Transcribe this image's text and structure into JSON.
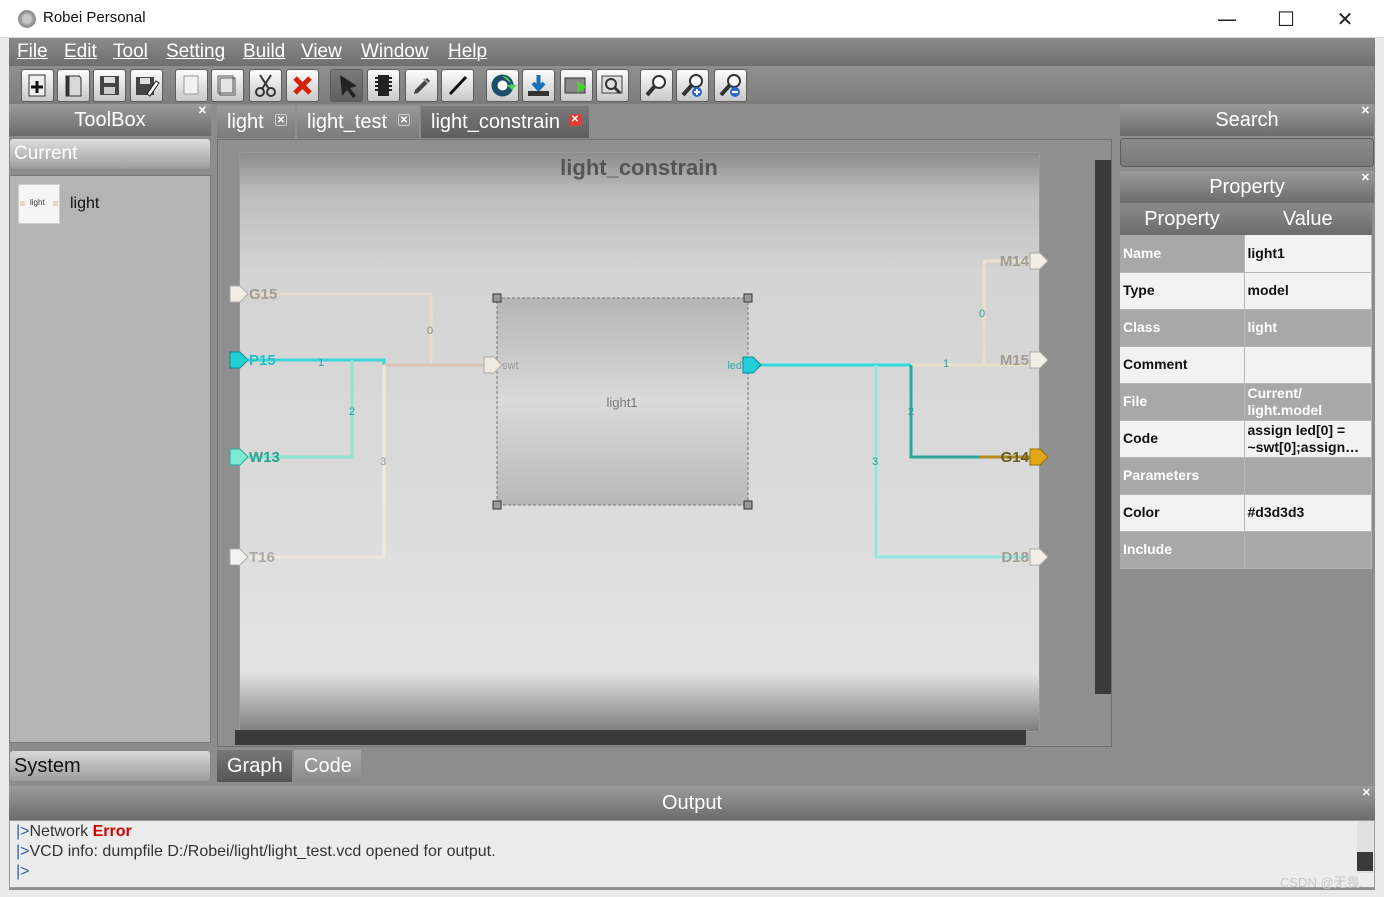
{
  "window": {
    "title": "Robei  Personal",
    "minimize": "—",
    "maximize": "☐",
    "close": "✕"
  },
  "menu": [
    "File",
    "Edit",
    "Tool",
    "Setting",
    "Build",
    "View",
    "Window",
    "Help"
  ],
  "toolbar": {
    "icons": [
      "new-file-icon",
      "open-book-icon",
      "save-icon",
      "save-as-icon",
      "copy-icon",
      "paste-icon",
      "cut-icon",
      "delete-icon",
      "pointer-icon",
      "chip-icon",
      "pen-icon",
      "wire-icon",
      "run-icon",
      "download-icon",
      "simulate-icon",
      "view-waveform-icon",
      "zoom-fit-icon",
      "zoom-in-icon",
      "zoom-out-icon"
    ]
  },
  "toolbox": {
    "title": "ToolBox",
    "current_label": "Current",
    "item_icon_text": "light",
    "item_label": "light",
    "system_label": "System"
  },
  "tabs": [
    {
      "label": "light",
      "active": false
    },
    {
      "label": "light_test",
      "active": false
    },
    {
      "label": "light_constrain",
      "active": true
    }
  ],
  "diagram": {
    "title": "light_constrain",
    "module_name": "light1",
    "module_input": "swt",
    "module_output": "led",
    "left_pins": [
      "G15",
      "P15",
      "W13",
      "T16"
    ],
    "right_pins": [
      "M14",
      "M15",
      "G14",
      "D18"
    ],
    "left_wire_labels": [
      "0",
      "1",
      "2",
      "3"
    ],
    "right_wire_labels": [
      "0",
      "1",
      "2",
      "3"
    ],
    "colors": {
      "cyan": "#33d6d6",
      "beige": "#eadfcf",
      "teal": "#2aa89a",
      "gold": "#e3a51a",
      "mint": "#8fe6cf"
    }
  },
  "bottom_tabs": [
    "Graph",
    "Code"
  ],
  "search": {
    "title": "Search"
  },
  "property": {
    "title": "Property",
    "headers": [
      "Property",
      "Value"
    ],
    "rows": [
      {
        "key": "Name",
        "value": "light1"
      },
      {
        "key": "Type",
        "value": "model"
      },
      {
        "key": "Class",
        "value": "light"
      },
      {
        "key": "Comment",
        "value": ""
      },
      {
        "key": "File",
        "value": "Current/ light.model"
      },
      {
        "key": "Code",
        "value": "assign led[0] = ~swt[0];assign…"
      },
      {
        "key": "Parameters",
        "value": ""
      },
      {
        "key": "Color",
        "value": "#d3d3d3"
      },
      {
        "key": "Include",
        "value": ""
      }
    ]
  },
  "output": {
    "title": "Output",
    "lines": [
      {
        "prefix": "|>",
        "text": "Network ",
        "error": "Error"
      },
      {
        "prefix": "|>",
        "text": "VCD info: dumpfile D:/Robei/light/light_test.vcd opened for output.",
        "error": ""
      },
      {
        "prefix": "|>",
        "text": "",
        "error": ""
      }
    ]
  },
  "watermark": "CSDN @无畏."
}
